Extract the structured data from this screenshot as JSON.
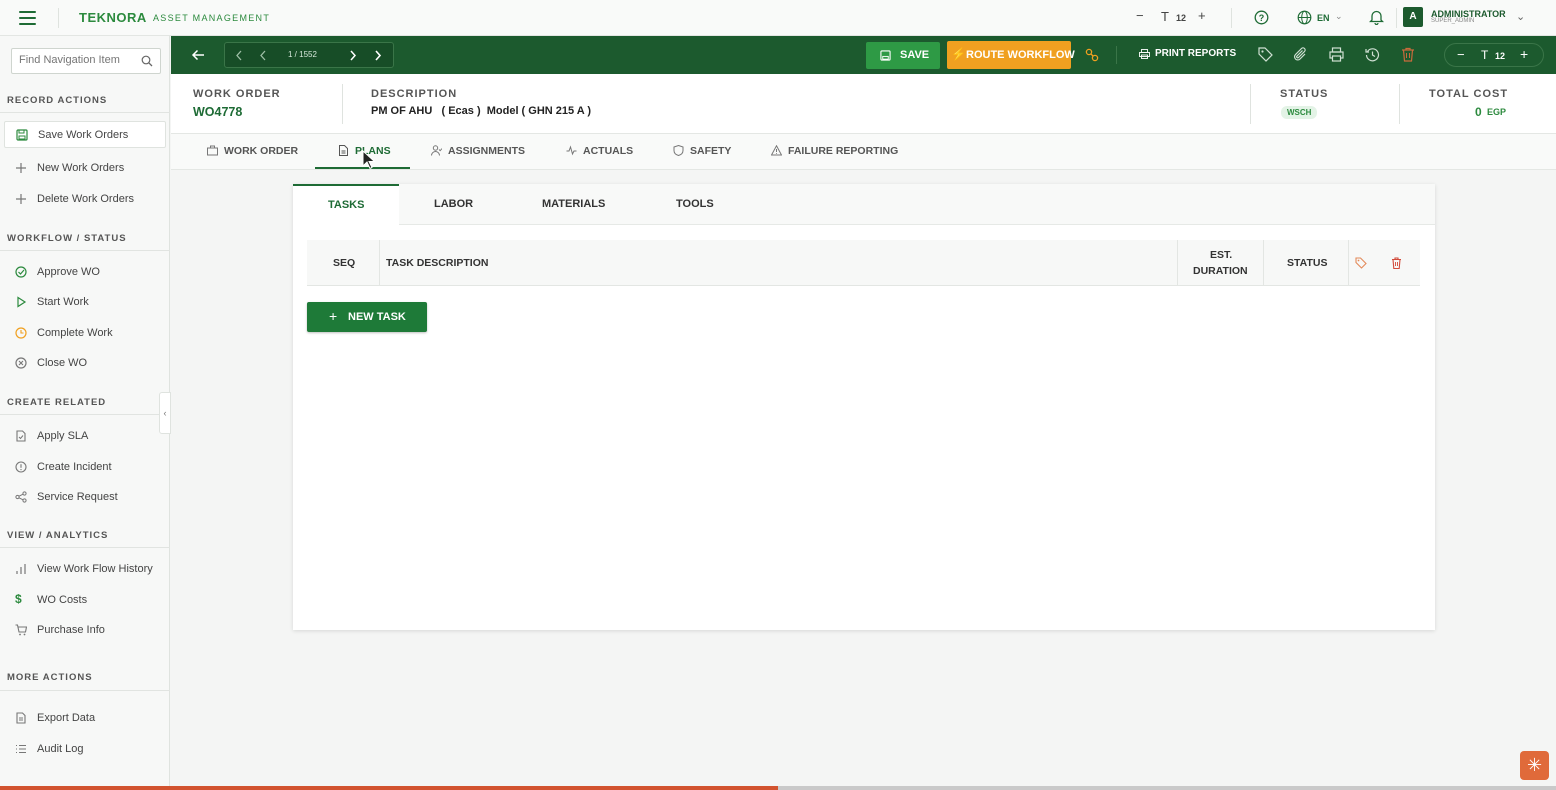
{
  "topbar": {
    "brand": "TEKNORA",
    "brand_sub": "ASSET MANAGEMENT",
    "font_size": "12",
    "language": "EN",
    "user_initial": "A",
    "user_name": "ADMINISTRATOR",
    "user_role": "SUPER_ADMIN"
  },
  "sidebar": {
    "search_placeholder": "Find Navigation Item",
    "sections": {
      "record_actions": "RECORD ACTIONS",
      "workflow_status": "WORKFLOW / STATUS",
      "create_related": "CREATE RELATED",
      "view_analytics": "VIEW / ANALYTICS",
      "more_actions": "MORE ACTIONS"
    },
    "items": {
      "save": "Save Work Orders",
      "new": "New Work Orders",
      "delete": "Delete Work Orders",
      "approve": "Approve WO",
      "start": "Start Work",
      "complete": "Complete Work",
      "close": "Close WO",
      "sla": "Apply SLA",
      "incident": "Create Incident",
      "service": "Service Request",
      "history": "View Work Flow History",
      "costs": "WO Costs",
      "purchase": "Purchase Info",
      "export": "Export Data",
      "audit": "Audit Log"
    }
  },
  "toolbar": {
    "pager": "1 / 1552",
    "save": "SAVE",
    "route": "ROUTE WORKFLOW",
    "print": "PRINT REPORTS",
    "font_size": "12"
  },
  "record": {
    "wo_label": "WORK ORDER",
    "wo_value": "WO4778",
    "desc_label": "DESCRIPTION",
    "desc_value": "PM OF AHU   ( Ecas )  Model ( GHN 215 A )",
    "status_label": "STATUS",
    "status_value": "WSCH",
    "cost_label": "TOTAL COST",
    "cost_value": "0",
    "cost_currency": "EGP"
  },
  "tabs": {
    "work_order": "WORK ORDER",
    "plans": "PLANS",
    "assignments": "ASSIGNMENTS",
    "actuals": "ACTUALS",
    "safety": "SAFETY",
    "failure": "FAILURE REPORTING"
  },
  "subtabs": {
    "tasks": "TASKS",
    "labor": "LABOR",
    "materials": "MATERIALS",
    "tools": "TOOLS"
  },
  "table": {
    "seq": "SEQ",
    "desc": "TASK DESCRIPTION",
    "duration_1": "EST.",
    "duration_2": "DURATION",
    "status": "STATUS"
  },
  "new_task": "NEW TASK",
  "progress": 0.5,
  "colors": {
    "brand_green": "#1c5a2e",
    "accent_orange": "#f0a020",
    "save_green": "#2e9a45",
    "progress_red": "#d2532f"
  }
}
